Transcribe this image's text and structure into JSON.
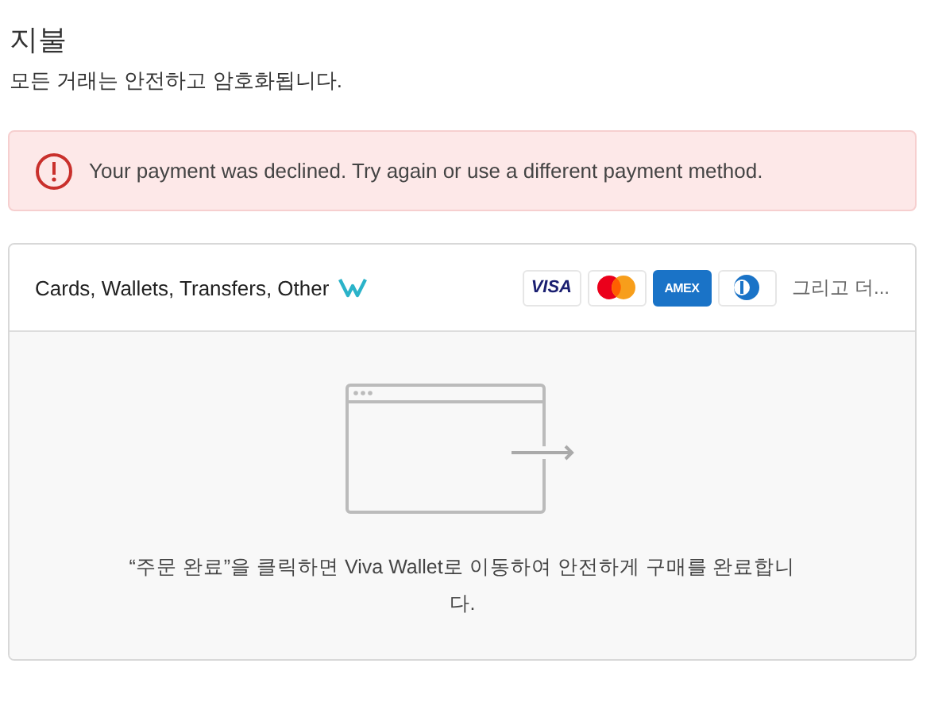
{
  "title": "지불",
  "subtitle": "모든 거래는 안전하고 암호화됩니다.",
  "alert": {
    "kind": "error",
    "message": "Your payment was declined. Try again or use a different payment method."
  },
  "payment_method": {
    "label": "Cards, Wallets, Transfers, Other",
    "selected": true,
    "cards": [
      {
        "kind": "visa",
        "label": "VISA"
      },
      {
        "kind": "mastercard"
      },
      {
        "kind": "amex",
        "label": "AMEX"
      },
      {
        "kind": "diners"
      }
    ],
    "more": "그리고 더...",
    "redirect_text": "“주문 완료”을 클릭하면 Viva Wallet로 이동하여 안전하게 구매를 완료합니다."
  }
}
